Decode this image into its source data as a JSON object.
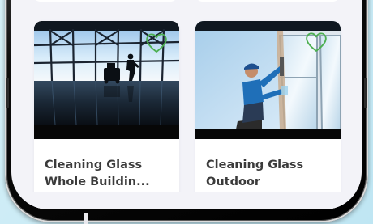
{
  "products": [
    {
      "title": "Cleaning Glass\nWhole Buildin...",
      "image_description": "",
      "favorite": false
    },
    {
      "title": "Cleaning Glass\nOutdoor",
      "image_description": "",
      "favorite": false
    }
  ],
  "colors": {
    "heart": "#4caf50",
    "background": "#f3f3f8",
    "card": "#ffffff",
    "title": "#3b3b3b"
  },
  "icons": {
    "favorite": "heart-outline-icon"
  }
}
